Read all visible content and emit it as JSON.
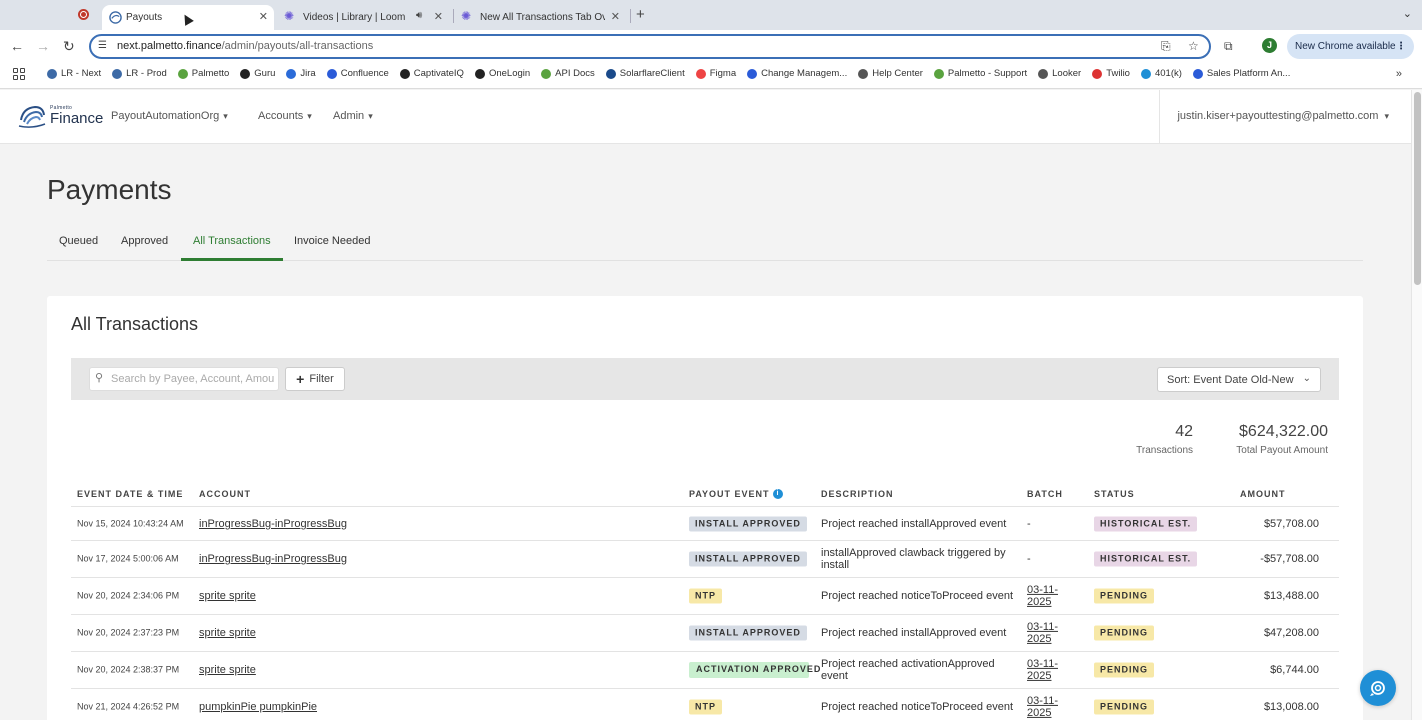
{
  "browser": {
    "tabs": [
      {
        "title": "Payouts",
        "active": true
      },
      {
        "title": "Videos | Library | Loom",
        "active": false
      },
      {
        "title": "New All Transactions Tab Ove",
        "active": false
      }
    ],
    "url_host": "next.palmetto.finance",
    "url_path": "/admin/payouts/all-transactions",
    "profile_initial": "J",
    "update_label": "New Chrome available",
    "bookmarks": [
      "LR - Next",
      "LR - Prod",
      "Palmetto",
      "Guru",
      "Jira",
      "Confluence",
      "CaptivateIQ",
      "OneLogin",
      "API Docs",
      "SolarflareClient",
      "Figma",
      "Change Managem...",
      "Help Center",
      "Palmetto - Support",
      "Looker",
      "Twilio",
      "401(k)",
      "Sales Platform An..."
    ]
  },
  "header": {
    "logo_small": "Palmetto",
    "logo_big": "Finance",
    "nav": [
      "PayoutAutomationOrg",
      "Accounts",
      "Admin"
    ],
    "user": "justin.kiser+payouttesting@palmetto.com"
  },
  "page": {
    "title": "Payments",
    "tabs": [
      "Queued",
      "Approved",
      "All Transactions",
      "Invoice Needed"
    ],
    "active_tab": "All Transactions"
  },
  "card": {
    "title": "All Transactions",
    "search_placeholder": "Search by Payee, Account, Amount",
    "filter_label": "Filter",
    "sort_label": "Sort: Event Date Old-New",
    "stats": {
      "count": "42",
      "count_label": "Transactions",
      "total": "$624,322.00",
      "total_label": "Total Payout Amount"
    }
  },
  "table": {
    "headers": [
      "EVENT DATE & TIME",
      "ACCOUNT",
      "PAYOUT EVENT",
      "DESCRIPTION",
      "BATCH",
      "STATUS",
      "AMOUNT"
    ],
    "rows": [
      {
        "date": "Nov 15, 2024 10:43:24 AM",
        "account": "inProgressBug-inProgressBug",
        "event": "INSTALL APPROVED",
        "event_kind": "install",
        "description": "Project reached installApproved event",
        "batch": "-",
        "status": "HISTORICAL EST.",
        "status_kind": "hist",
        "amount": "$57,708.00"
      },
      {
        "date": "Nov 17, 2024 5:00:06 AM",
        "account": "inProgressBug-inProgressBug",
        "event": "INSTALL APPROVED",
        "event_kind": "install",
        "description": "installApproved clawback triggered by install",
        "batch": "-",
        "status": "HISTORICAL EST.",
        "status_kind": "hist",
        "amount": "-$57,708.00"
      },
      {
        "date": "Nov 20, 2024 2:34:06 PM",
        "account": "sprite sprite",
        "event": "NTP",
        "event_kind": "ntp",
        "description": "Project reached noticeToProceed event",
        "batch": "03-11-2025",
        "status": "PENDING",
        "status_kind": "pending",
        "amount": "$13,488.00"
      },
      {
        "date": "Nov 20, 2024 2:37:23 PM",
        "account": "sprite sprite",
        "event": "INSTALL APPROVED",
        "event_kind": "install",
        "description": "Project reached installApproved event",
        "batch": "03-11-2025",
        "status": "PENDING",
        "status_kind": "pending",
        "amount": "$47,208.00"
      },
      {
        "date": "Nov 20, 2024 2:38:37 PM",
        "account": "sprite sprite",
        "event": "ACTIVATION APPROVED",
        "event_kind": "activation",
        "description": "Project reached activationApproved event",
        "batch": "03-11-2025",
        "status": "PENDING",
        "status_kind": "pending",
        "amount": "$6,744.00"
      },
      {
        "date": "Nov 21, 2024 4:26:52 PM",
        "account": "pumpkinPie pumpkinPie",
        "event": "NTP",
        "event_kind": "ntp",
        "description": "Project reached noticeToProceed event",
        "batch": "03-11-2025",
        "status": "PENDING",
        "status_kind": "pending",
        "amount": "$13,008.00"
      }
    ]
  },
  "colors": {
    "accent_green": "#2e7d32",
    "info_blue": "#1f8fd6",
    "pending_yellow": "#f7e8a7",
    "historical_pink": "#e8d6e6"
  },
  "icons": [
    "record-icon",
    "palmetto-favicon",
    "loom-icon",
    "speaker-icon",
    "search-icon",
    "plus-icon",
    "info-icon",
    "help-chat-icon"
  ]
}
